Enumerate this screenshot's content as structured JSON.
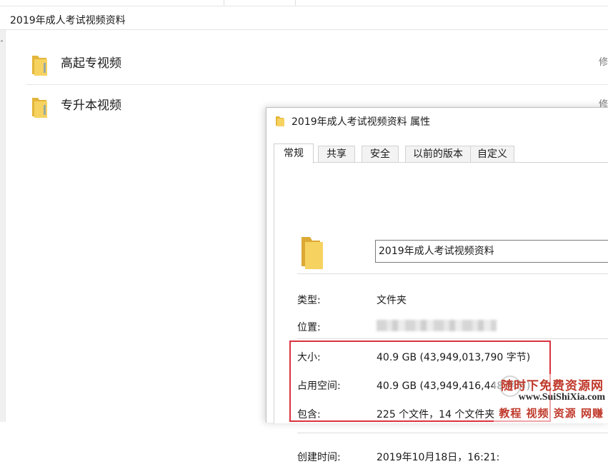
{
  "explorer": {
    "address": "2019年成人考试视频资料",
    "items": [
      {
        "name": "高起专视频",
        "column_fragment": "修"
      },
      {
        "name": "专升本视频",
        "column_fragment": "修"
      }
    ]
  },
  "dialog": {
    "title": "2019年成人考试视频资料 属性",
    "tabs": [
      "常规",
      "共享",
      "安全",
      "以前的版本",
      "自定义"
    ],
    "active_tab": "常规",
    "name_value": "2019年成人考试视频资料",
    "properties": {
      "type_label": "类型:",
      "type_value": "文件夹",
      "location_label": "位置:",
      "size_label": "大小:",
      "size_value": "40.9 GB (43,949,013,790 字节)",
      "disk_label": "占用空间:",
      "disk_value": "40.9 GB (43,949,416,448 字节)",
      "contains_label": "包含:",
      "contains_value": "225 个文件，14 个文件夹",
      "created_label": "创建时间:",
      "created_value": "2019年10月18日，16:21:"
    }
  },
  "watermark": {
    "line1": "随时下免费资源网",
    "line2": "www.SuiShiXia.com",
    "line3": "教程 视频 资源 网赚"
  },
  "colors": {
    "highlight_border": "#d9333f",
    "folder_yellow": "#f3c94c",
    "watermark_red": "#c0392b"
  }
}
